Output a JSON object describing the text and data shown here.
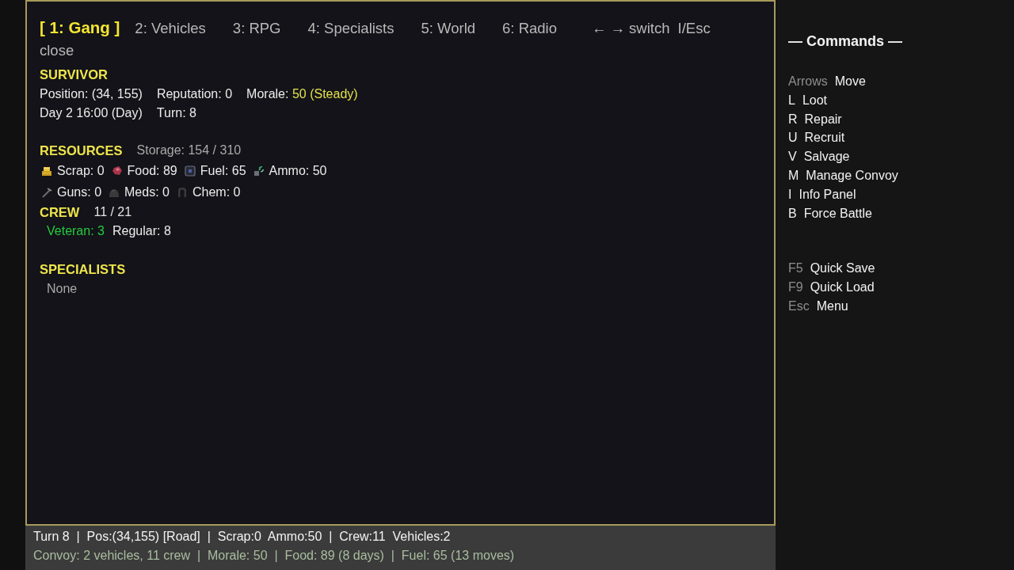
{
  "tabs": [
    {
      "label": "[ 1: Gang ]",
      "selected": true
    },
    {
      "label": "2: Vehicles",
      "selected": false
    },
    {
      "label": "3: RPG",
      "selected": false
    },
    {
      "label": "4: Specialists",
      "selected": false
    },
    {
      "label": "5: World",
      "selected": false
    },
    {
      "label": "6: Radio",
      "selected": false
    }
  ],
  "key_hints": [
    {
      "keys": "← →",
      "action": "switch"
    },
    {
      "keys": "I/Esc",
      "action": "close"
    }
  ],
  "survivor": {
    "heading": "SURVIVOR",
    "rows": [
      [
        {
          "label": "Position:",
          "value": "(34, 155)",
          "highlight": false
        },
        {
          "label": "Reputation:",
          "value": "0",
          "highlight": false
        },
        {
          "label": "Morale:",
          "value": "50 (Steady)",
          "highlight": true
        }
      ],
      [
        {
          "label": "Day 2",
          "value": "16:00 (Day)",
          "highlight": false
        },
        {
          "label": "Turn:",
          "value": "8",
          "highlight": false
        }
      ]
    ]
  },
  "resources": {
    "heading": "RESOURCES",
    "storage": "Storage: 154 / 310",
    "rows": [
      [
        {
          "kind": "scrap",
          "text": "Scrap: 0"
        },
        {
          "kind": "food",
          "text": "Food: 89"
        },
        {
          "kind": "fuel",
          "text": "Fuel: 65"
        },
        {
          "kind": "ammo",
          "text": "Ammo: 50"
        }
      ],
      [
        {
          "kind": "guns",
          "text": "Guns: 0"
        },
        {
          "kind": "meds",
          "text": "Meds: 0"
        },
        {
          "kind": "chem",
          "text": "Chem: 0"
        }
      ]
    ]
  },
  "crew": {
    "heading": "CREW",
    "count": "11 / 21",
    "groups": [
      {
        "text": "Veteran: 3",
        "color": "#22cc3c"
      },
      {
        "text": "Regular: 8",
        "color": "#ececec"
      }
    ]
  },
  "specialists": {
    "heading": "SPECIALISTS",
    "empty_text": "None"
  },
  "commands": {
    "title": "— Commands —",
    "groups": [
      [
        {
          "key": "Arrows",
          "action": "Move",
          "key_dim": true
        },
        {
          "key": "L",
          "action": "Loot",
          "key_dim": false
        },
        {
          "key": "R",
          "action": "Repair",
          "key_dim": false
        },
        {
          "key": "U",
          "action": "Recruit",
          "key_dim": false
        },
        {
          "key": "V",
          "action": "Salvage",
          "key_dim": false
        },
        {
          "key": "M",
          "action": "Manage Convoy",
          "key_dim": false
        },
        {
          "key": "I",
          "action": "Info Panel",
          "key_dim": false
        },
        {
          "key": "B",
          "action": "Force Battle",
          "key_dim": false
        }
      ],
      [
        {
          "key": "F5",
          "action": "Quick Save",
          "key_dim": true
        },
        {
          "key": "F9",
          "action": "Quick Load",
          "key_dim": true
        },
        {
          "key": "Esc",
          "action": "Menu",
          "key_dim": true
        }
      ]
    ]
  },
  "status_bar": {
    "lines": [
      {
        "kind": "primary",
        "text": "Turn 8  |  Pos:(34,155) [Road]  |  Scrap:0  Ammo:50  |  Crew:11  Vehicles:2"
      },
      {
        "kind": "secondary",
        "text": "Convoy: 2 vehicles, 11 crew  |  Morale: 50  |  Food: 89 (8 days)  |  Fuel: 65 (13 moves)"
      }
    ]
  }
}
